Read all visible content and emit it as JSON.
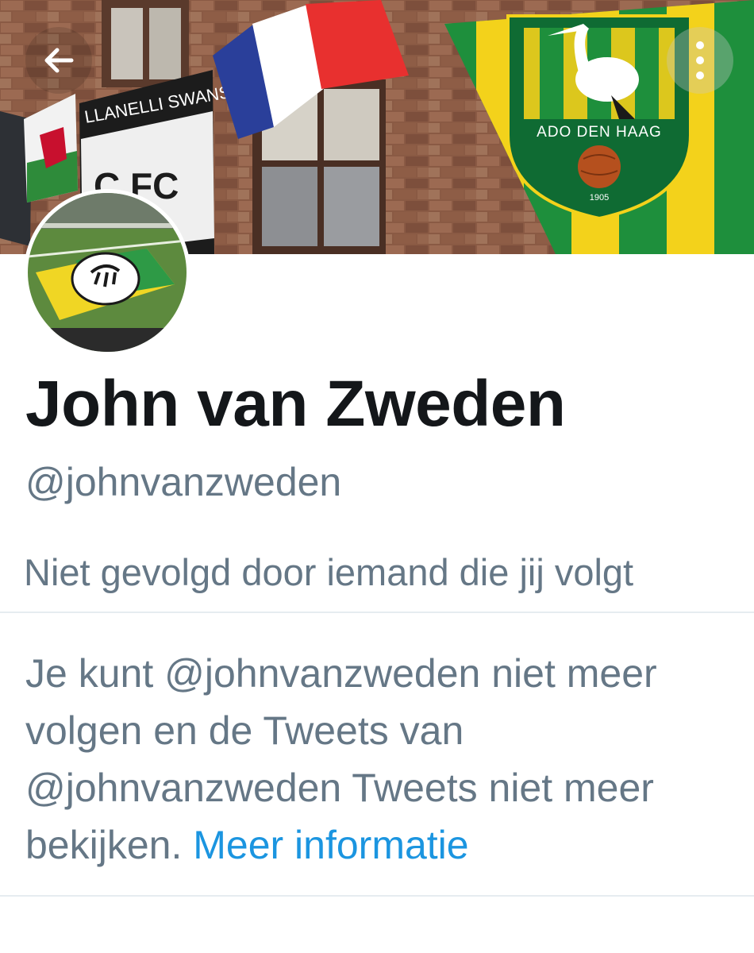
{
  "banner": {
    "icons": {
      "back": "arrow-left-icon",
      "more": "more-vertical-icon"
    },
    "flag_text": {
      "ado_name": "ADO DEN HAAG",
      "ado_year": "1905",
      "club_flag": "C FC",
      "club_banner_top": "LLANELLI SWANS"
    }
  },
  "profile": {
    "display_name": "John van Zweden",
    "handle": "@johnvanzweden",
    "followed_by_context": "Niet gevolgd door iemand die jij volgt"
  },
  "blocked_notice": {
    "text": "Je kunt @johnvanzweden niet meer volgen en de Tweets van @johnvanzweden Tweets niet meer bekijken.",
    "link_label": "Meer informatie"
  },
  "colors": {
    "primary_text": "#14171a",
    "secondary_text": "#657786",
    "link": "#1b95e0",
    "divider": "#e6ecf0"
  }
}
